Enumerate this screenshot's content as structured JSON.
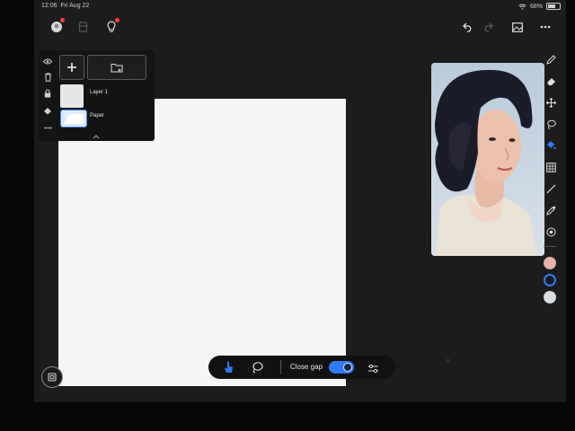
{
  "status": {
    "time": "12:06",
    "date": "Fri Aug 22",
    "battery": "68%"
  },
  "header": {
    "left_icons": [
      "profile-icon",
      "store-icon",
      "tips-icon"
    ],
    "right_icons": [
      "undo-icon",
      "redo-icon",
      "gallery-icon",
      "more-icon"
    ]
  },
  "layers": {
    "side_icons": [
      "eye-icon",
      "trash-icon",
      "lock-icon",
      "fill-icon",
      "more-dots-icon"
    ],
    "items": [
      {
        "label": "Layer 1"
      },
      {
        "label": "Paper"
      }
    ]
  },
  "tools": [
    "pen-icon",
    "eraser-icon",
    "move-icon",
    "lasso-icon",
    "fill-bucket-icon",
    "grid-icon",
    "line-icon",
    "eyedropper-icon",
    "stamp-icon"
  ],
  "swatches": [
    "#e6b3a8",
    "#1b1b1b",
    "#d9dde2"
  ],
  "bottom_bar": {
    "close_gap_label": "Close gap",
    "close_gap_on": true
  },
  "colors": {
    "accent": "#2f7bff",
    "panel": "#141414",
    "paper": "#f4f5f5"
  }
}
